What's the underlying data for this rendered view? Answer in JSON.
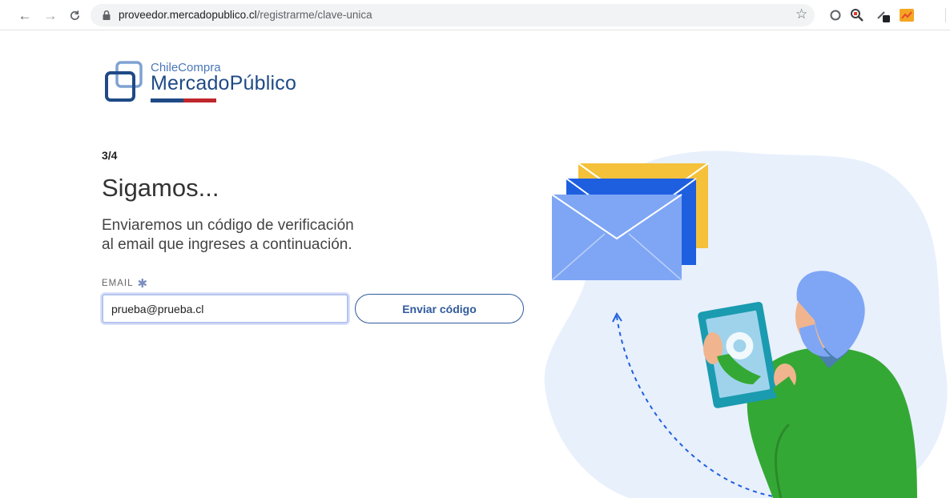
{
  "browser": {
    "url_host": "proveedor.mercadopublico.cl",
    "url_path": "/registrarme/clave-unica",
    "icons": [
      "back-arrow-icon",
      "forward-arrow-icon",
      "reload-icon",
      "lock-icon",
      "bookmark-star-icon",
      "extension-icons"
    ]
  },
  "logo": {
    "sub": "ChileCompra",
    "main": "MercadoPúblico",
    "colors": {
      "blue": "#1f4a86",
      "red": "#c0272d"
    }
  },
  "form": {
    "step": "3/4",
    "title": "Sigamos...",
    "description_line1": "Enviaremos un código de verificación",
    "description_line2": "al email que ingreses a continuación.",
    "email_label": "EMAIL",
    "email_value": "prueba@prueba.cl",
    "send_button": "Enviar código"
  },
  "colors": {
    "accent": "#305a9c",
    "input_focus": "#b5c3ef",
    "blob": "#e8f0fc"
  }
}
